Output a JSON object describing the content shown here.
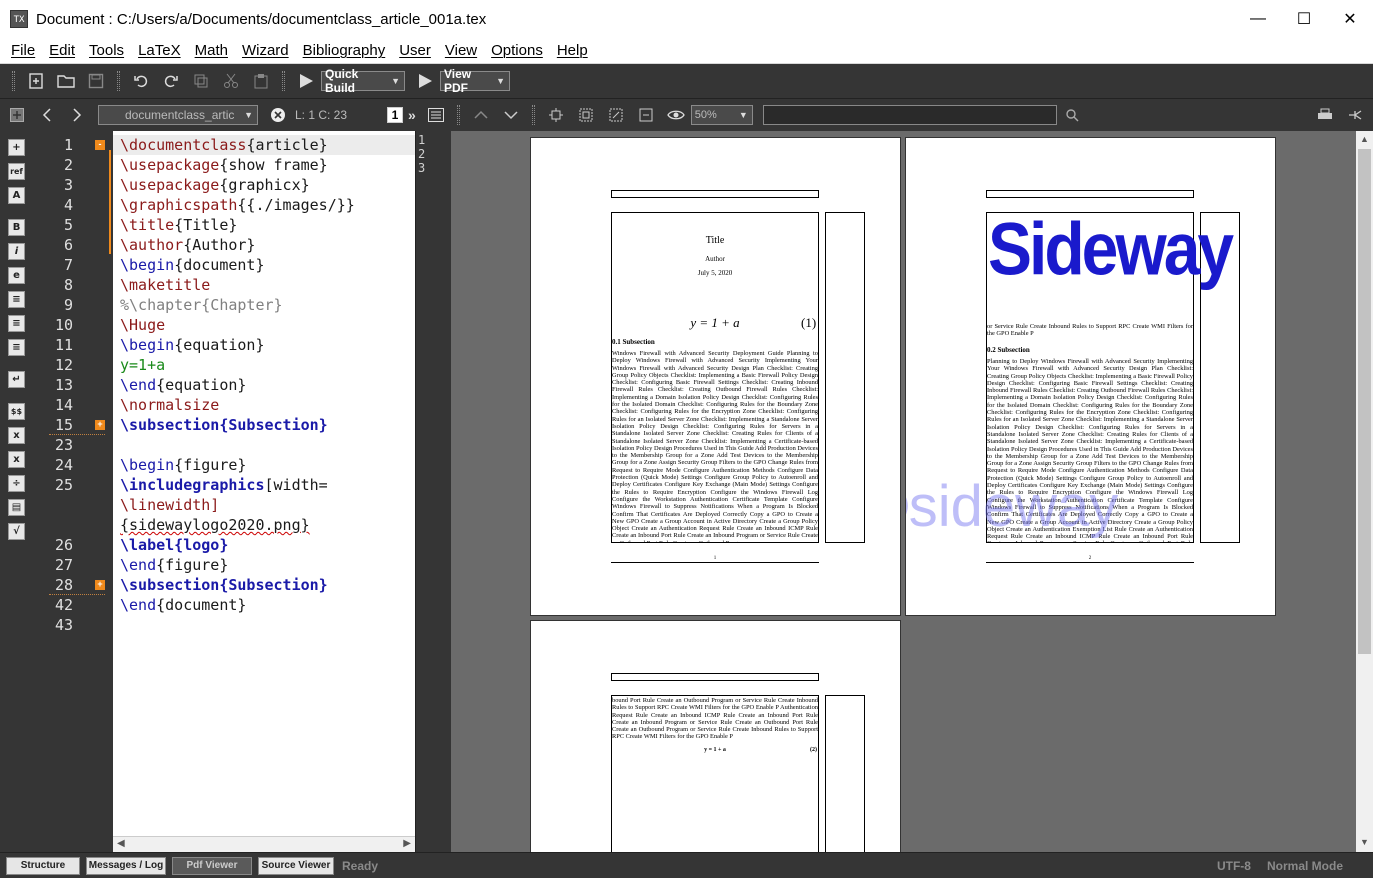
{
  "window": {
    "title": "Document : C:/Users/a/Documents/documentclass_article_001a.tex",
    "minimize": "—",
    "maximize": "☐",
    "close": "✕"
  },
  "menu": [
    "File",
    "Edit",
    "Tools",
    "LaTeX",
    "Math",
    "Wizard",
    "Bibliography",
    "User",
    "View",
    "Options",
    "Help"
  ],
  "toolbar": {
    "quick_build": "Quick Build",
    "view_pdf": "View PDF"
  },
  "nav": {
    "doc_tab": "documentclass_artic",
    "cursor": "L: 1 C: 23",
    "page_number": "1",
    "zoom": "50%",
    "search_placeholder": ""
  },
  "sidebar_icons": [
    "ref",
    "A",
    "B",
    "i",
    "e"
  ],
  "editor": {
    "line_numbers": [
      "1",
      "2",
      "3",
      "4",
      "5",
      "6",
      "7",
      "8",
      "9",
      "10",
      "11",
      "12",
      "13",
      "14",
      "15",
      "23",
      "24",
      "25",
      "",
      "",
      "26",
      "27",
      "28",
      "42",
      "43"
    ],
    "lines": [
      {
        "a": "\\documentclass",
        "b": "{article}"
      },
      {
        "a": "\\usepackage",
        "b": "{show frame}"
      },
      {
        "a": "\\usepackage",
        "b": "{graphicx}"
      },
      {
        "a": "\\graphicspath",
        "b": "{{./images/}}"
      },
      {
        "a": "\\title",
        "b": "{Title}"
      },
      {
        "a": "\\author",
        "b": "{Author}"
      },
      {
        "a": "\\begin",
        "b": "{document}"
      },
      {
        "a": "\\maketitle",
        "b": ""
      },
      {
        "a": "%\\chapter{Chapter}",
        "b": ""
      },
      {
        "a": "\\Huge",
        "b": ""
      },
      {
        "a": "\\begin",
        "b": "{equation}"
      },
      {
        "a": "y=1+a",
        "b": ""
      },
      {
        "a": "\\end",
        "b": "{equation}"
      },
      {
        "a": "\\normalsize",
        "b": ""
      },
      {
        "a": "\\subsection{Subsection}",
        "b": ""
      },
      {
        "a": "",
        "b": ""
      },
      {
        "a": "\\begin",
        "b": "{figure}"
      },
      {
        "a": "\\includegraphics",
        "b": "[width="
      },
      {
        "a": "\\linewidth]",
        "b": ""
      },
      {
        "a": "{sidewaylogo2020.png}",
        "b": ""
      },
      {
        "a": "\\label{logo}",
        "b": ""
      },
      {
        "a": "\\end",
        "b": "{figure}"
      },
      {
        "a": "\\subsection{Subsection}",
        "b": ""
      },
      {
        "a": "\\end",
        "b": "{document}"
      },
      {
        "a": "",
        "b": ""
      }
    ]
  },
  "pdf_lines": [
    "1",
    "2",
    "3"
  ],
  "pdf": {
    "page1": {
      "title": "Title",
      "author": "Author",
      "date": "July 5, 2020",
      "equation": "y = 1 + a",
      "eqnum": "(1)",
      "section": "0.1    Subsection",
      "body": "Windows Firewall with Advanced Security Deployment Guide Planning to Deploy Windows Firewall with Advanced Security Implementing Your Windows Firewall with Advanced Security Design Plan Checklist: Creating Group Policy Objects Checklist: Implementing a Basic Firewall Policy Design Checklist: Configuring Basic Firewall Settings Checklist: Creating Inbound Firewall Rules Checklist: Creating Outbound Firewall Rules Checklist: Implementing a Domain Isolation Policy Design Checklist: Configuring Rules for the Isolated Domain Checklist: Configuring Rules for the Boundary Zone Checklist: Configuring Rules for the Encryption Zone Checklist: Configuring Rules for an Isolated Server Zone Checklist: Implementing a Standalone Server Isolation Policy Design Checklist: Configuring Rules for Servers in a Standalone Isolated Server Zone Checklist: Creating Rules for Clients of a Standalone Isolated Server Zone Checklist: Implementing a Certificate-based Isolation Policy Design Procedures Used in This Guide Add Production Devices to the Membership Group for a Zone Add Test Devices to the Membership Group for a Zone Assign Security Group Filters to the GPO Change Rules from Request to Require Mode Configure Authentication Methods Configure Data Protection (Quick Mode) Settings Configure Group Policy to Autoenroll and Deploy Certificates Configure Key Exchange (Main Mode) Settings Configure the Rules to Require Encryption Configure the Windows Firewall Log Configure the Workstation Authentication Certificate Template Configure Windows Firewall to Suppress Notifications When a Program Is Blocked Confirm That Certificates Are Deployed Correctly Copy a GPO to Create a New GPO Create a Group Account in Active Directory Create a Group Policy Object Create an Authentication Request Rule Create an Inbound ICMP Rule Create an Inbound Port Rule Create an Inbound Program or Service Rule Create an Outbound Port Rule Create an Outbound Program",
      "page_num": "1"
    },
    "page2": {
      "logo": "Sideway",
      "caption": "or Service Rule Create Inbound Rules to Support RPC Create WMI Filters for the GPO Enable P",
      "section": "0.2    Subsection",
      "body": "Planning to Deploy Windows Firewall with Advanced Security Implementing Your Windows Firewall with Advanced Security Design Plan Checklist: Creating Group Policy Objects Checklist: Implementing a Basic Firewall Policy Design Checklist: Configuring Basic Firewall Settings Checklist: Creating Inbound Firewall Rules Checklist: Creating Outbound Firewall Rules Checklist: Implementing a Domain Isolation Policy Design Checklist: Configuring Rules for the Isolated Domain Checklist: Configuring Rules for the Boundary Zone Checklist: Configuring Rules for the Encryption Zone Checklist: Configuring Rules for an Isolated Server Zone Checklist: Implementing a Standalone Server Isolation Policy Design Checklist: Configuring Rules for Servers in a Standalone Isolated Server Zone Checklist: Creating Rules for Clients of a Standalone Isolated Server Zone Checklist: Implementing a Certificate-based Isolation Policy Design Procedures Used in This Guide Add Production Devices to the Membership Group for a Zone Add Test Devices to the Membership Group for a Zone Assign Security Group Filters to the GPO Change Rules from Request to Require Mode Configure Authentication Methods Configure Data Protection (Quick Mode) Settings Configure Group Policy to Autoenroll and Deploy Certificates Configure Key Exchange (Main Mode) Settings Configure the Rules to Require Encryption Configure the Windows Firewall Log Configure the Workstation Authentication Certificate Template Configure Windows Firewall to Suppress Notifications When a Program Is Blocked Confirm That Certificates Are Deployed Correctly Copy a GPO to Create a New GPO Create a Group Account in Active Directory Create a Group Policy Object Create an Authentication Exemption List Rule Create an Authentication Request Rule Create an Inbound ICMP Rule Create an Inbound Port Rule Create an Inbound Program or Service Rule Create an Outbound Port Rule Create an Outbound Program",
      "watermark": "©sideway",
      "page_num": "2"
    },
    "page3": {
      "body": "bound Port Rule Create an Outbound Program or Service Rule Create Inbound Rules to Support RPC Create WMI Filters for the GPO Enable P Authentication Request Rule Create an Inbound ICMP Rule Create an Inbound Port Rule Create an Inbound Program or Service Rule Create an Outbound Port Rule Create an Outbound Program or Service Rule Create Inbound Rules to Support RPC Create WMI Filters for the GPO Enable P",
      "equation": "y = 1 + a",
      "eqnum": "(2)"
    }
  },
  "status": {
    "structure": "Structure",
    "messages": "Messages / Log",
    "pdf_viewer": "Pdf Viewer",
    "source_viewer": "Source Viewer",
    "state": "Ready",
    "encoding": "UTF-8",
    "mode": "Normal Mode"
  }
}
